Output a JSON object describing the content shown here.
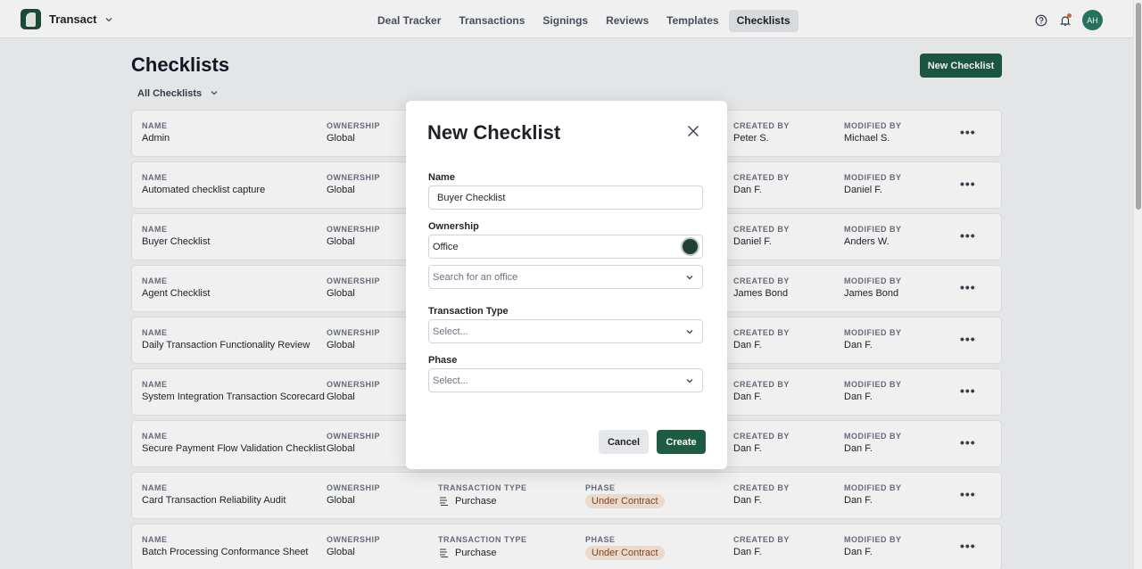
{
  "app": {
    "name": "Transact"
  },
  "nav": {
    "items": [
      {
        "label": "Deal Tracker"
      },
      {
        "label": "Transactions"
      },
      {
        "label": "Signings"
      },
      {
        "label": "Reviews"
      },
      {
        "label": "Templates"
      },
      {
        "label": "Checklists",
        "active": true
      }
    ]
  },
  "user": {
    "initials": "AH"
  },
  "page": {
    "title": "Checklists",
    "filter_label": "All Checklists",
    "new_button": "New Checklist"
  },
  "columns": {
    "name": "NAME",
    "ownership": "OWNERSHIP",
    "transaction_type": "TRANSACTION TYPE",
    "phase": "PHASE",
    "created_by": "CREATED BY",
    "modified_by": "MODIFIED BY"
  },
  "rows": [
    {
      "name": "Admin",
      "ownership": "Global",
      "created_by": "Peter S.",
      "modified_by": "Michael S."
    },
    {
      "name": "Automated checklist capture",
      "ownership": "Global",
      "created_by": "Dan F.",
      "modified_by": "Daniel F."
    },
    {
      "name": "Buyer Checklist",
      "ownership": "Global",
      "created_by": "Daniel F.",
      "modified_by": "Anders W."
    },
    {
      "name": "Agent Checklist",
      "ownership": "Global",
      "created_by": "James Bond",
      "modified_by": "James Bond"
    },
    {
      "name": "Daily Transaction Functionality Review",
      "ownership": "Global",
      "created_by": "Dan F.",
      "modified_by": "Dan F."
    },
    {
      "name": "System Integration Transaction Scorecard",
      "ownership": "Global",
      "created_by": "Dan F.",
      "modified_by": "Dan F."
    },
    {
      "name": "Secure Payment Flow Validation Checklist",
      "ownership": "Global",
      "created_by": "Dan F.",
      "modified_by": "Dan F."
    },
    {
      "name": "Card Transaction Reliability Audit",
      "ownership": "Global",
      "transaction_type": "Purchase",
      "phase": "Under Contract",
      "created_by": "Dan F.",
      "modified_by": "Dan F."
    },
    {
      "name": "Batch Processing Conformance Sheet",
      "ownership": "Global",
      "transaction_type": "Purchase",
      "phase": "Under Contract",
      "created_by": "Dan F.",
      "modified_by": "Dan F."
    }
  ],
  "modal": {
    "title": "New Checklist",
    "name_label": "Name",
    "name_value": "Buyer Checklist",
    "ownership_label": "Ownership",
    "ownership_value": "Office",
    "office_placeholder": "Search for an office",
    "transaction_type_label": "Transaction Type",
    "transaction_type_placeholder": "Select...",
    "phase_label": "Phase",
    "phase_placeholder": "Select...",
    "cancel": "Cancel",
    "create": "Create"
  },
  "colors": {
    "accent": "#1d5b43",
    "avatar": "#2a7a64",
    "phase_pill_bg": "#f8e8da",
    "phase_pill_text": "#8a4b1f"
  }
}
